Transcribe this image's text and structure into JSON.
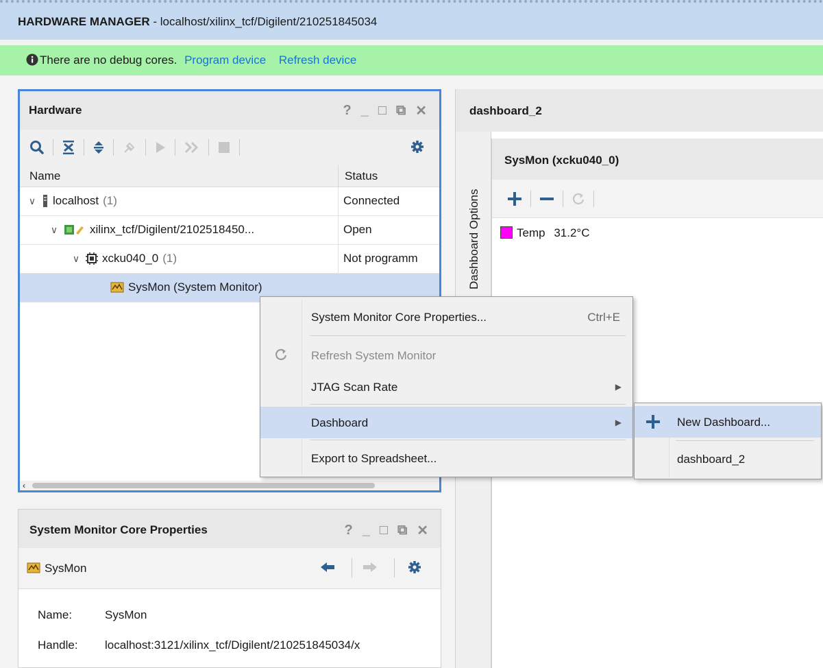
{
  "manager": {
    "title_bold": "HARDWARE MANAGER",
    "title_rest": " - localhost/xilinx_tcf/Digilent/210251845034"
  },
  "infobar": {
    "message": "There are no debug cores.",
    "link1": "Program device",
    "link2": "Refresh device"
  },
  "hardware_panel": {
    "title": "Hardware",
    "columns": {
      "name": "Name",
      "status": "Status"
    },
    "rows": [
      {
        "label": "localhost",
        "count": "(1)",
        "status": "Connected"
      },
      {
        "label": "xilinx_tcf/Digilent/2102518450...",
        "count": "",
        "status": "Open"
      },
      {
        "label": "xcku040_0",
        "count": "(1)",
        "status": "Not programm"
      },
      {
        "label": "SysMon (System Monitor)",
        "count": "",
        "status": ""
      }
    ]
  },
  "context_menu": {
    "items": [
      {
        "label": "System Monitor Core Properties...",
        "shortcut": "Ctrl+E"
      },
      {
        "label": "Refresh System Monitor"
      },
      {
        "label": "JTAG Scan Rate"
      },
      {
        "label": "Dashboard"
      },
      {
        "label": "Export to Spreadsheet..."
      }
    ]
  },
  "dashboard_submenu": {
    "items": [
      {
        "label": "New Dashboard..."
      },
      {
        "label": "dashboard_2"
      }
    ]
  },
  "properties_panel": {
    "title": "System Monitor Core Properties",
    "object": "SysMon",
    "fields": [
      {
        "key": "Name:",
        "value": "SysMon"
      },
      {
        "key": "Handle:",
        "value": "localhost:3121/xilinx_tcf/Digilent/210251845034/x"
      }
    ]
  },
  "dashboard": {
    "tab": "dashboard_2",
    "side_tab": "Dashboard Options",
    "sysmon_title": "SysMon (xcku040_0)",
    "legend": [
      {
        "label": "Temp",
        "value": "31.2°C",
        "color": "#ff00ff"
      }
    ]
  },
  "window_controls": [
    "?",
    "_",
    "□",
    "⧉",
    "✕"
  ],
  "colors": {
    "title_bar": "#c5d9f1",
    "info_bar": "#a6f2a8",
    "selection": "#cddcf3",
    "focus_border": "#4a86d8",
    "link": "#1874d1"
  }
}
